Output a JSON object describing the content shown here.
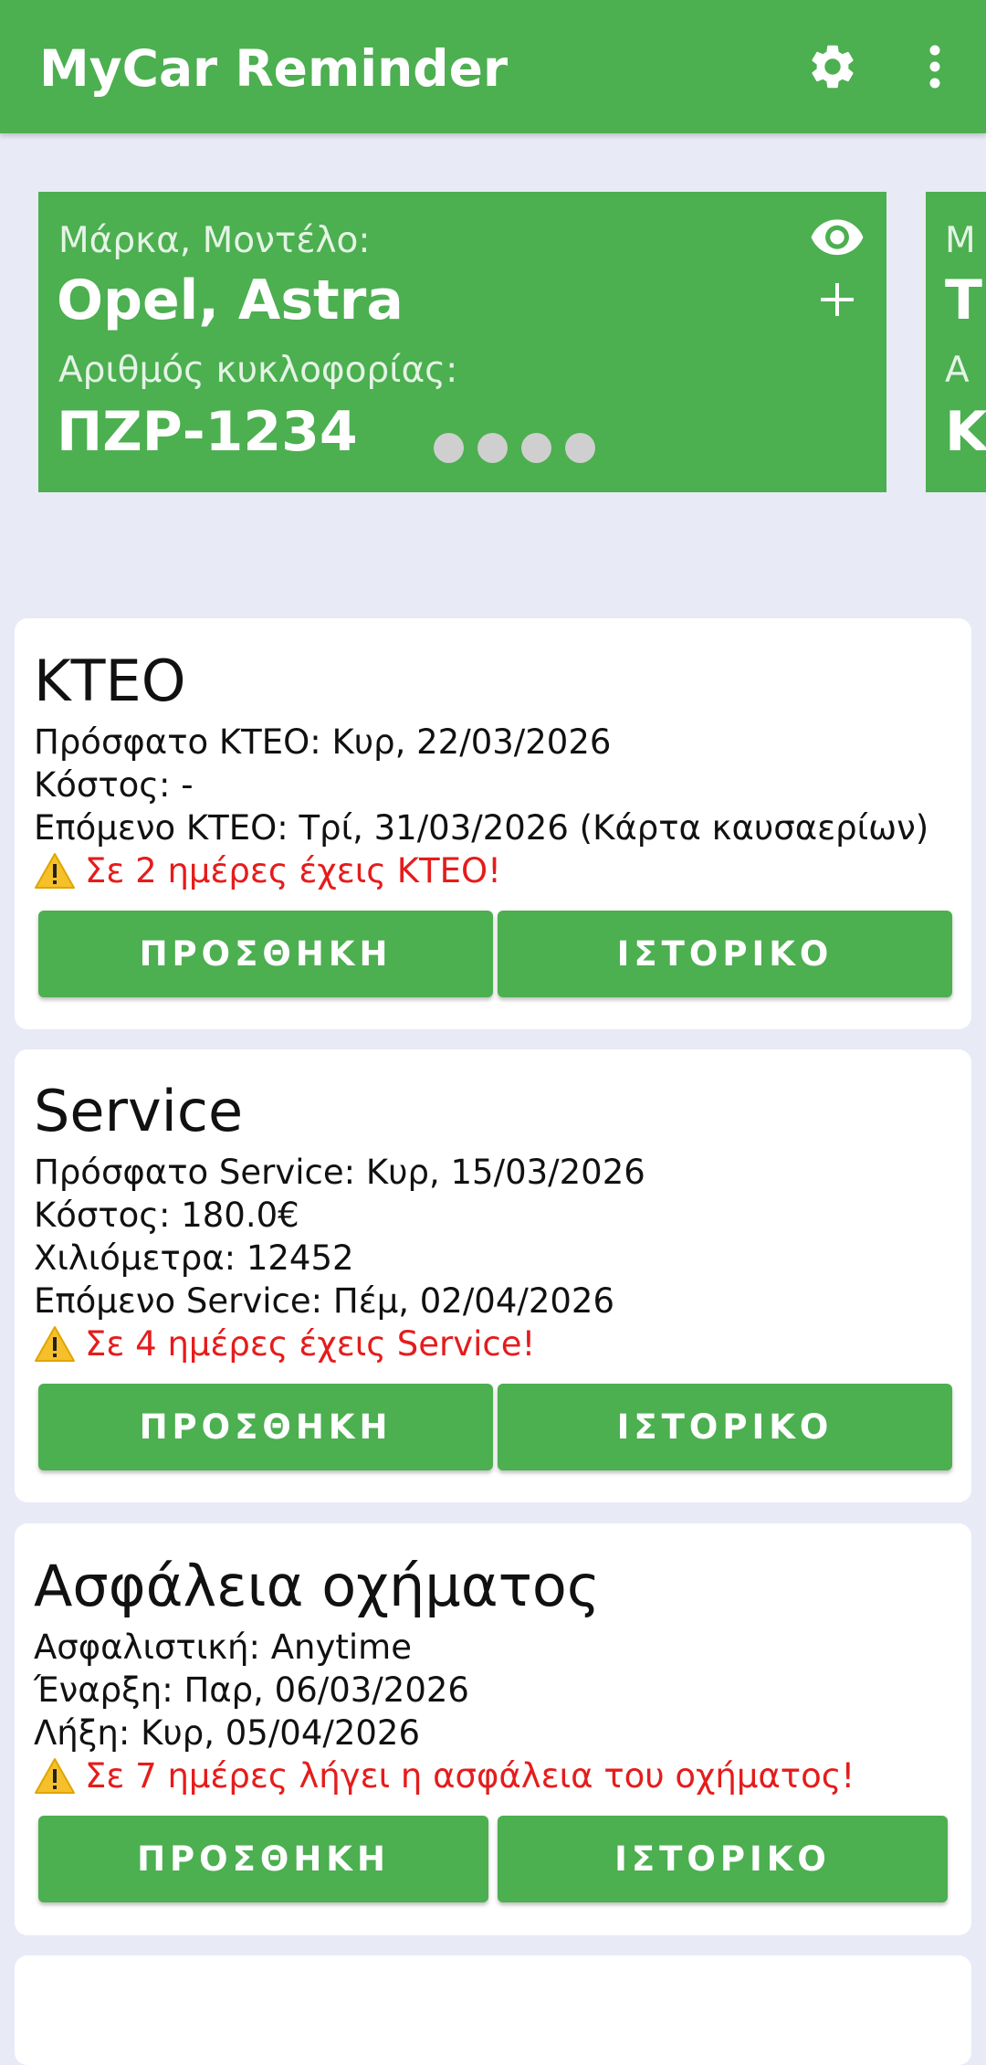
{
  "app": {
    "title": "MyCar Reminder",
    "settings_icon": "gear-icon",
    "more_icon": "more-vertical-icon"
  },
  "colors": {
    "primary": "#4caf50",
    "background": "#e8eaf6",
    "warning_text": "#e51c1c",
    "dot_inactive": "#cfcfcf"
  },
  "carousel": {
    "page_count": 5,
    "active_page": 1,
    "cars": [
      {
        "make_model_label": "Μάρκα, Μοντέλο:",
        "make_model": "Opel, Astra",
        "plate_label": "Αριθμός κυκλοφορίας:",
        "plate": "ΠΖΡ-1234",
        "view_icon": "eye-icon",
        "add_icon": "plus-icon"
      },
      {
        "make_model_label": "Μ",
        "make_model": "Τ",
        "plate_label": "Α",
        "plate": "Κ"
      }
    ]
  },
  "sections": {
    "kteo": {
      "title": "ΚΤΕΟ",
      "lines": [
        "Πρόσφατο ΚΤΕΟ: Κυρ, 22/03/2026",
        "Κόστος: -",
        "Επόμενο ΚΤΕΟ: Τρί, 31/03/2026 (Κάρτα καυσαερίων)"
      ],
      "warning": "Σε 2 ημέρες έχεις ΚΤΕΟ!",
      "warning_icon": "warning-icon",
      "add_label": "ΠΡΟΣΘΗΚΗ",
      "history_label": "ΙΣΤΟΡΙΚΟ"
    },
    "service": {
      "title": "Service",
      "lines": [
        "Πρόσφατο Service: Κυρ, 15/03/2026",
        "Κόστος: 180.0€",
        "Χιλιόμετρα: 12452",
        "Επόμενο Service: Πέμ, 02/04/2026"
      ],
      "warning": "Σε 4 ημέρες έχεις Service!",
      "warning_icon": "warning-icon",
      "add_label": "ΠΡΟΣΘΗΚΗ",
      "history_label": "ΙΣΤΟΡΙΚΟ"
    },
    "insurance": {
      "title": "Ασφάλεια οχήματος",
      "lines": [
        "Ασφαλιστική: Anytime",
        "Έναρξη: Παρ, 06/03/2026",
        "Λήξη: Κυρ, 05/04/2026"
      ],
      "warning": "Σε 7 ημέρες λήγει η ασφάλεια του οχήματος!",
      "warning_icon": "warning-icon",
      "add_label": "ΠΡΟΣΘΗΚΗ",
      "history_label": "ΙΣΤΟΡΙΚΟ"
    }
  }
}
